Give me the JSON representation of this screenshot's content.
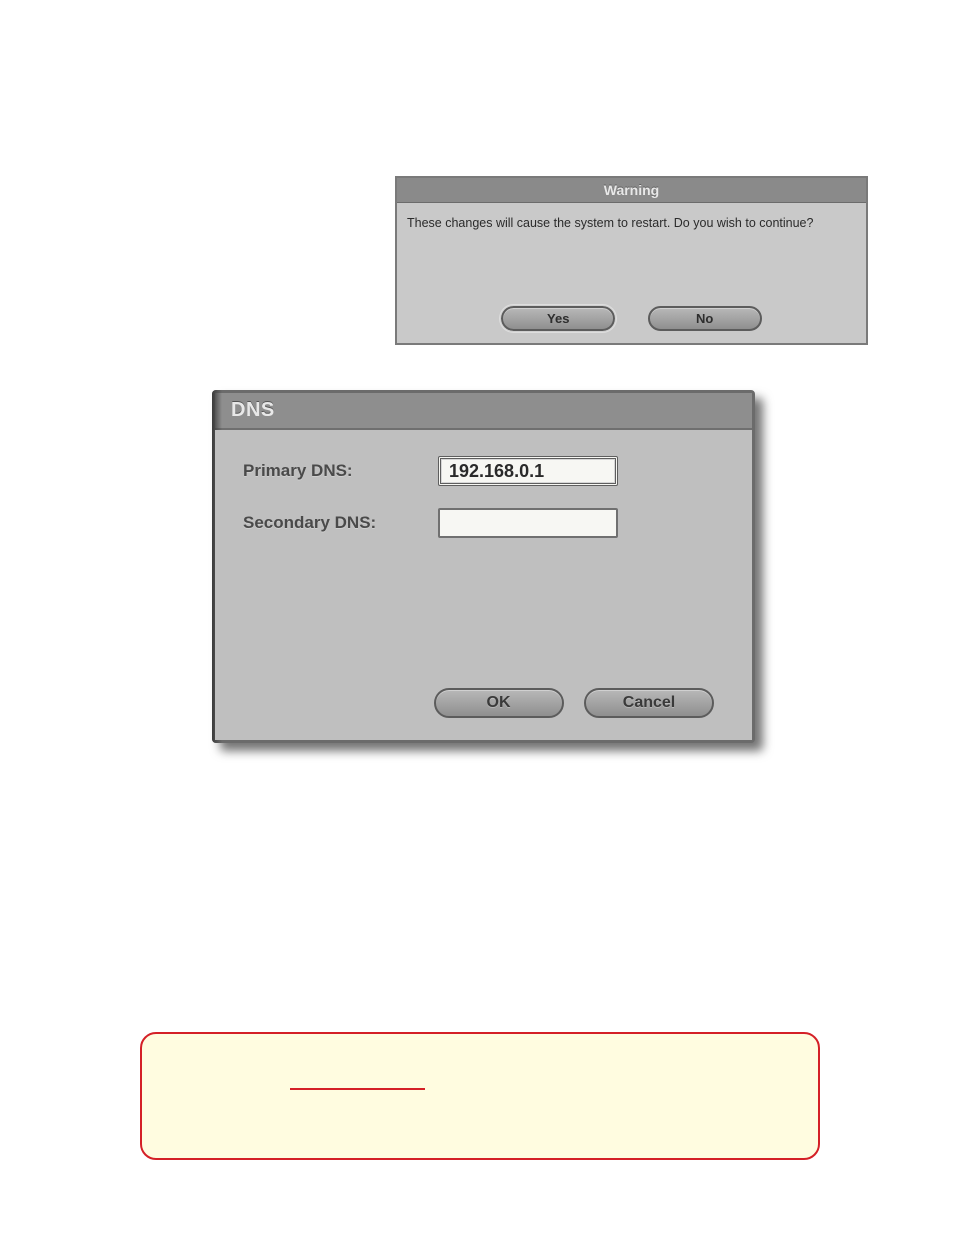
{
  "warning_dialog": {
    "title": "Warning",
    "message": "These changes will cause the system to restart.  Do you wish to continue?",
    "buttons": {
      "yes": "Yes",
      "no": "No"
    }
  },
  "dns_dialog": {
    "title": "DNS",
    "primary_label": "Primary DNS:",
    "primary_value": "192.168.0.1",
    "secondary_label": "Secondary DNS:",
    "secondary_value": "",
    "buttons": {
      "ok": "OK",
      "cancel": "Cancel"
    }
  }
}
